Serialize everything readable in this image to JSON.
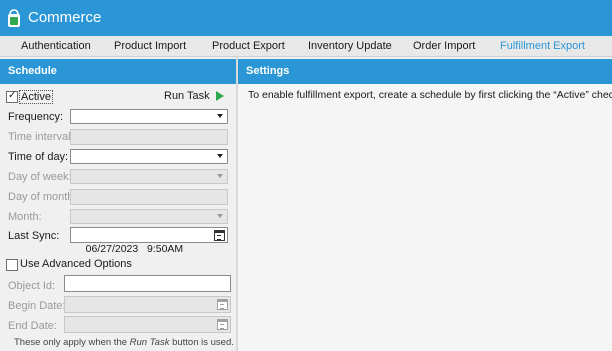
{
  "app": {
    "title": "Commerce"
  },
  "tabs": [
    {
      "label": "Authentication"
    },
    {
      "label": "Product Import"
    },
    {
      "label": "Product Export"
    },
    {
      "label": "Inventory Update"
    },
    {
      "label": "Order Import"
    },
    {
      "label": "Fulfillment Export",
      "active": true
    }
  ],
  "schedule": {
    "header": "Schedule",
    "active_label": "Active",
    "active_checked": true,
    "run_task_label": "Run Task",
    "fields": {
      "frequency": {
        "label": "Frequency:",
        "value": ""
      },
      "time_interval": {
        "label": "Time interval:",
        "value": ""
      },
      "time_of_day": {
        "label": "Time of day:",
        "value": ""
      },
      "day_of_week": {
        "label": "Day of week:",
        "value": ""
      },
      "day_of_month": {
        "label": "Day of month:",
        "value": ""
      },
      "month": {
        "label": "Month:",
        "value": ""
      },
      "last_sync": {
        "label": "Last Sync:",
        "value": "06/27/2023   9:50AM"
      }
    },
    "advanced": {
      "label": "Use Advanced Options",
      "checked": false,
      "object_id": {
        "label": "Object Id:",
        "value": ""
      },
      "begin_date": {
        "label": "Begin Date:",
        "value": ""
      },
      "end_date": {
        "label": "End Date:",
        "value": ""
      },
      "note_prefix": "These only apply when the ",
      "note_em": "Run Task",
      "note_suffix": " button is used."
    }
  },
  "settings": {
    "header": "Settings",
    "message": "To enable fulfillment export, create a schedule by first clicking the “Active” checkbox."
  },
  "colors": {
    "accent": "#2a96d6",
    "play": "#2fa84f"
  }
}
